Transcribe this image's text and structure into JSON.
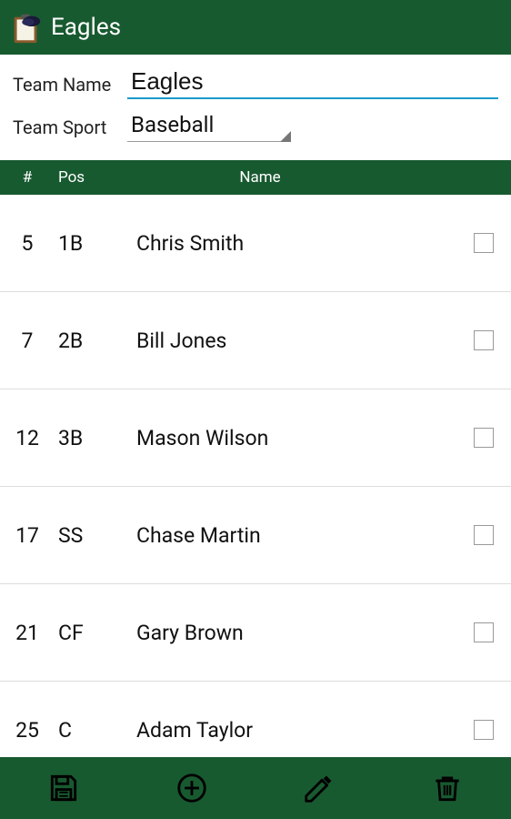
{
  "colors": {
    "primary": "#185a30",
    "accent": "#1a9bcb"
  },
  "action_bar": {
    "title": "Eagles",
    "icon": "baseball-cap-clipboard"
  },
  "form": {
    "team_name": {
      "label": "Team Name",
      "value": "Eagles"
    },
    "team_sport": {
      "label": "Team Sport",
      "value": "Baseball"
    }
  },
  "table": {
    "headers": {
      "number": "#",
      "position": "Pos",
      "name": "Name"
    }
  },
  "players": [
    {
      "number": "5",
      "position": "1B",
      "name": "Chris Smith",
      "checked": false
    },
    {
      "number": "7",
      "position": "2B",
      "name": "Bill Jones",
      "checked": false
    },
    {
      "number": "12",
      "position": "3B",
      "name": "Mason Wilson",
      "checked": false
    },
    {
      "number": "17",
      "position": "SS",
      "name": "Chase Martin",
      "checked": false
    },
    {
      "number": "21",
      "position": "CF",
      "name": "Gary Brown",
      "checked": false
    },
    {
      "number": "25",
      "position": "C",
      "name": "Adam Taylor",
      "checked": false
    }
  ],
  "toolbar": {
    "save": "Save",
    "add": "Add",
    "edit": "Edit",
    "delete": "Delete"
  }
}
